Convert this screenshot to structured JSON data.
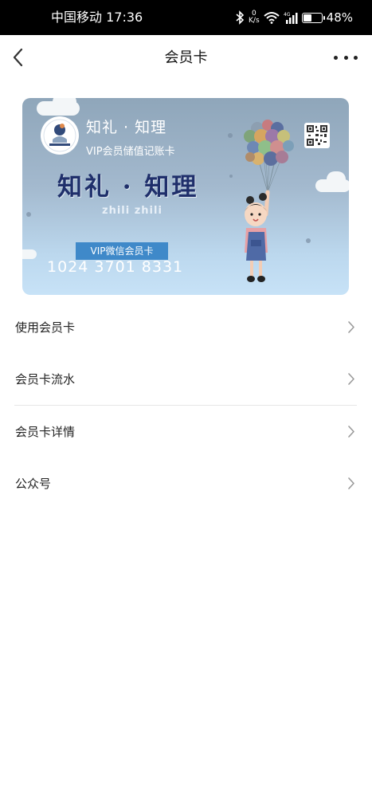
{
  "status_bar": {
    "carrier_time": "中国移动 17:36",
    "net_speed_value": "0",
    "net_speed_unit": "K/s",
    "network": "4G",
    "battery_percent": "48%",
    "battery_level": 0.48
  },
  "nav": {
    "title": "会员卡",
    "back_icon": "chevron-left-icon",
    "more_icon": "more-dots-icon"
  },
  "card": {
    "name": "知礼 · 知理",
    "subtitle": "VIP会员储值记账卡",
    "big_title": "知礼 · 知理",
    "pinyin": "zhili zhili",
    "badge": "VIP微信会员卡",
    "number": "1024 3701 8331",
    "colors": {
      "top": "#8fa6ba",
      "bottom": "#c7e2f7",
      "badge": "#3f89c9",
      "title": "#1f2f6b"
    }
  },
  "menu": {
    "items": [
      {
        "label": "使用会员卡"
      },
      {
        "label": "会员卡流水"
      },
      {
        "label": "会员卡详情"
      },
      {
        "label": "公众号"
      }
    ]
  }
}
